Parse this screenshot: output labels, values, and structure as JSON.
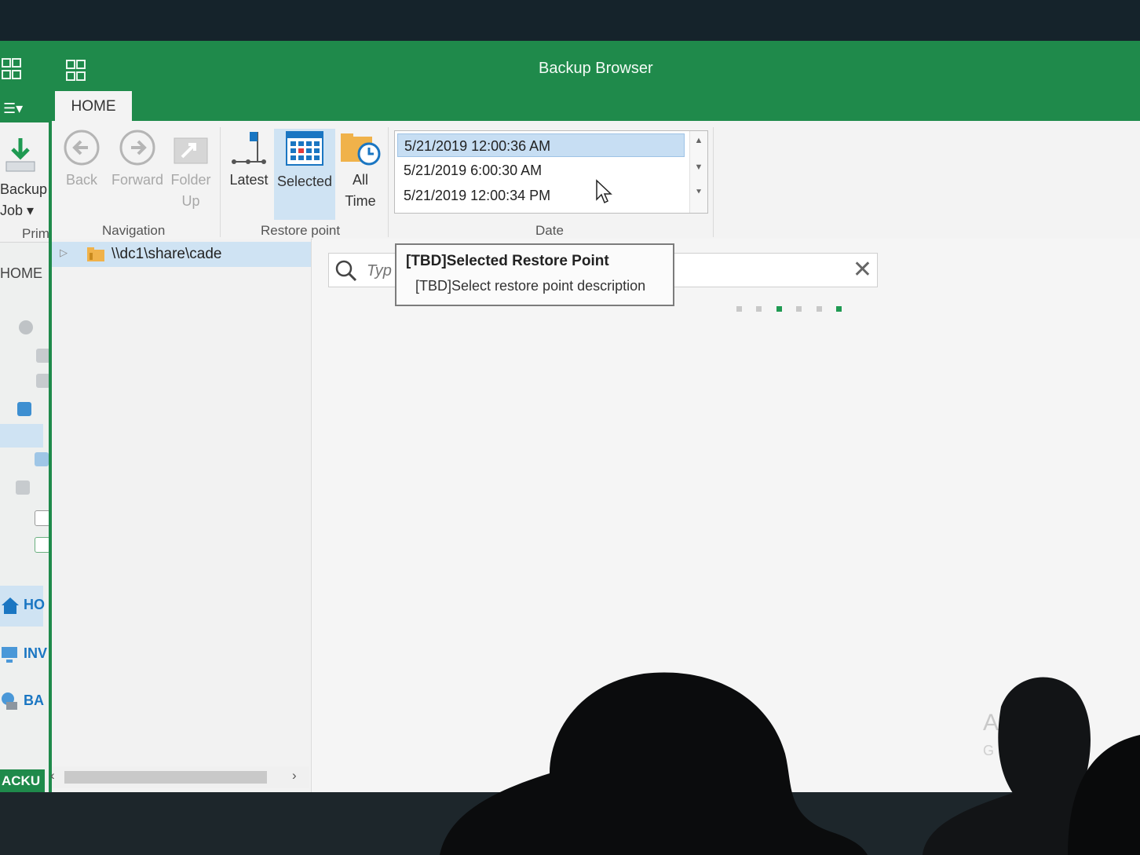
{
  "bg_window": {
    "ribbon_button_line1": "Backup",
    "ribbon_button_line2": "Job ▾",
    "group_label": "Prim",
    "home_label": "HOME",
    "nav_home": "HO",
    "nav_inventory": "INV",
    "nav_backup": "BA",
    "footer": "ACKU"
  },
  "window": {
    "title": "Backup Browser",
    "tab_home": "HOME"
  },
  "ribbon": {
    "back": "Back",
    "forward": "Forward",
    "folder_up_line1": "Folder",
    "folder_up_line2": "Up",
    "latest": "Latest",
    "selected": "Selected",
    "all_time_line1": "All",
    "all_time_line2": "Time",
    "group_navigation": "Navigation",
    "group_restore_point": "Restore point",
    "group_date": "Date"
  },
  "dates": [
    "5/21/2019 12:00:36 AM",
    "5/21/2019 6:00:30 AM",
    "5/21/2019 12:00:34 PM"
  ],
  "tree": {
    "path": "\\\\dc1\\share\\cade"
  },
  "search": {
    "placeholder": "Typ"
  },
  "tooltip": {
    "title": "[TBD]Selected Restore Point",
    "description": "[TBD]Select restore point description"
  },
  "watermark": {
    "line1": "A      Wind",
    "line2": "G"
  },
  "colors": {
    "accent": "#1f8a4b",
    "selection": "#c7def3",
    "progress_active": "#1f9a52"
  }
}
